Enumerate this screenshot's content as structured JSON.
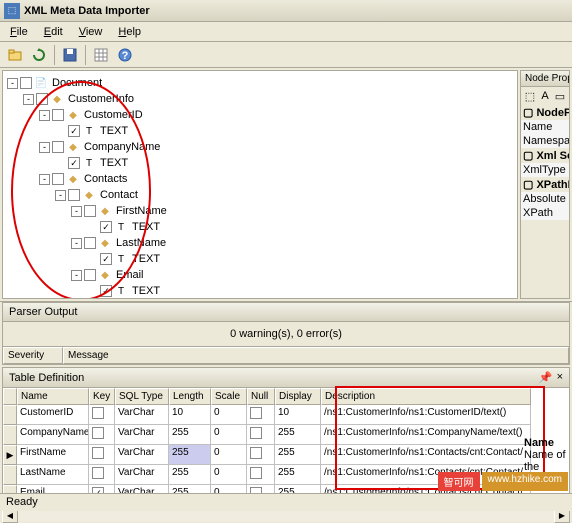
{
  "title": "XML Meta Data Importer",
  "menu": {
    "file": "File",
    "edit": "Edit",
    "view": "View",
    "help": "Help"
  },
  "tree": [
    {
      "indent": 0,
      "expand": "-",
      "check": false,
      "icon": "📄",
      "iconColor": "#d4a84b",
      "label": "Document"
    },
    {
      "indent": 1,
      "expand": "-",
      "check": false,
      "icon": "◆",
      "iconColor": "#d4a84b",
      "label": "CustomerInfo"
    },
    {
      "indent": 2,
      "expand": "-",
      "check": false,
      "icon": "◆",
      "iconColor": "#d4a84b",
      "label": "CustomerID"
    },
    {
      "indent": 3,
      "expand": "",
      "check": true,
      "icon": "T",
      "iconColor": "#000",
      "label": "TEXT"
    },
    {
      "indent": 2,
      "expand": "-",
      "check": false,
      "icon": "◆",
      "iconColor": "#d4a84b",
      "label": "CompanyName"
    },
    {
      "indent": 3,
      "expand": "",
      "check": true,
      "icon": "T",
      "iconColor": "#000",
      "label": "TEXT"
    },
    {
      "indent": 2,
      "expand": "-",
      "check": false,
      "icon": "◆",
      "iconColor": "#d4a84b",
      "label": "Contacts"
    },
    {
      "indent": 3,
      "expand": "-",
      "check": false,
      "icon": "◆",
      "iconColor": "#d4a84b",
      "label": "Contact"
    },
    {
      "indent": 4,
      "expand": "-",
      "check": false,
      "icon": "◆",
      "iconColor": "#d4a84b",
      "label": "FirstName"
    },
    {
      "indent": 5,
      "expand": "",
      "check": true,
      "icon": "T",
      "iconColor": "#000",
      "label": "TEXT"
    },
    {
      "indent": 4,
      "expand": "-",
      "check": false,
      "icon": "◆",
      "iconColor": "#d4a84b",
      "label": "LastName"
    },
    {
      "indent": 5,
      "expand": "",
      "check": true,
      "icon": "T",
      "iconColor": "#000",
      "label": "TEXT"
    },
    {
      "indent": 4,
      "expand": "-",
      "check": false,
      "icon": "◆",
      "iconColor": "#d4a84b",
      "label": "Email"
    },
    {
      "indent": 5,
      "expand": "",
      "check": true,
      "icon": "T",
      "iconColor": "#000",
      "label": "TEXT"
    }
  ],
  "nodeProps": {
    "title": "Node Proper",
    "cats": [
      "NodePro",
      "Xml Sch",
      "XPathEx"
    ],
    "labels": [
      "Name",
      "Namespac",
      "XmlType",
      "Absolute",
      "XPath"
    ]
  },
  "parser": {
    "title": "Parser Output",
    "status": "0 warning(s), 0 error(s)",
    "severity": "Severity",
    "message": "Message"
  },
  "tableDef": {
    "title": "Table Definition",
    "pin": "📌",
    "close": "×",
    "headers": {
      "name": "Name",
      "key": "Key",
      "sql": "SQL Type",
      "len": "Length",
      "scale": "Scale",
      "null": "Null",
      "disp": "Display",
      "desc": "Description"
    },
    "rows": [
      {
        "sel": "",
        "name": "CustomerID",
        "key": false,
        "sql": "VarChar",
        "len": "10",
        "scale": "0",
        "null": false,
        "disp": "10",
        "desc": "/ns1:CustomerInfo/ns1:CustomerID/text()"
      },
      {
        "sel": "",
        "name": "CompanyName",
        "key": false,
        "sql": "VarChar",
        "len": "255",
        "scale": "0",
        "null": false,
        "disp": "255",
        "desc": "/ns1:CustomerInfo/ns1:CompanyName/text()"
      },
      {
        "sel": "▶",
        "name": "FirstName",
        "key": false,
        "sql": "VarChar",
        "len": "255",
        "lenSel": true,
        "scale": "0",
        "null": false,
        "disp": "255",
        "desc": "/ns1:CustomerInfo/ns1:Contacts/cnt:Contact/"
      },
      {
        "sel": "",
        "name": "LastName",
        "key": false,
        "sql": "VarChar",
        "len": "255",
        "scale": "0",
        "null": false,
        "disp": "255",
        "desc": "/ns1:CustomerInfo/ns1:Contacts/cnt:Contact/"
      },
      {
        "sel": "",
        "name": "Email",
        "key": true,
        "sql": "VarChar",
        "len": "255",
        "scale": "0",
        "null": false,
        "disp": "255",
        "desc": "/ns1:CustomerInfo/ns1:Contacts/cnt:Contact/"
      }
    ]
  },
  "rightBottom": {
    "name": "Name",
    "nameOf": "Name of the"
  },
  "status": "Ready",
  "watermark": {
    "a": "智可网",
    "b": "www.hzhike.com"
  }
}
